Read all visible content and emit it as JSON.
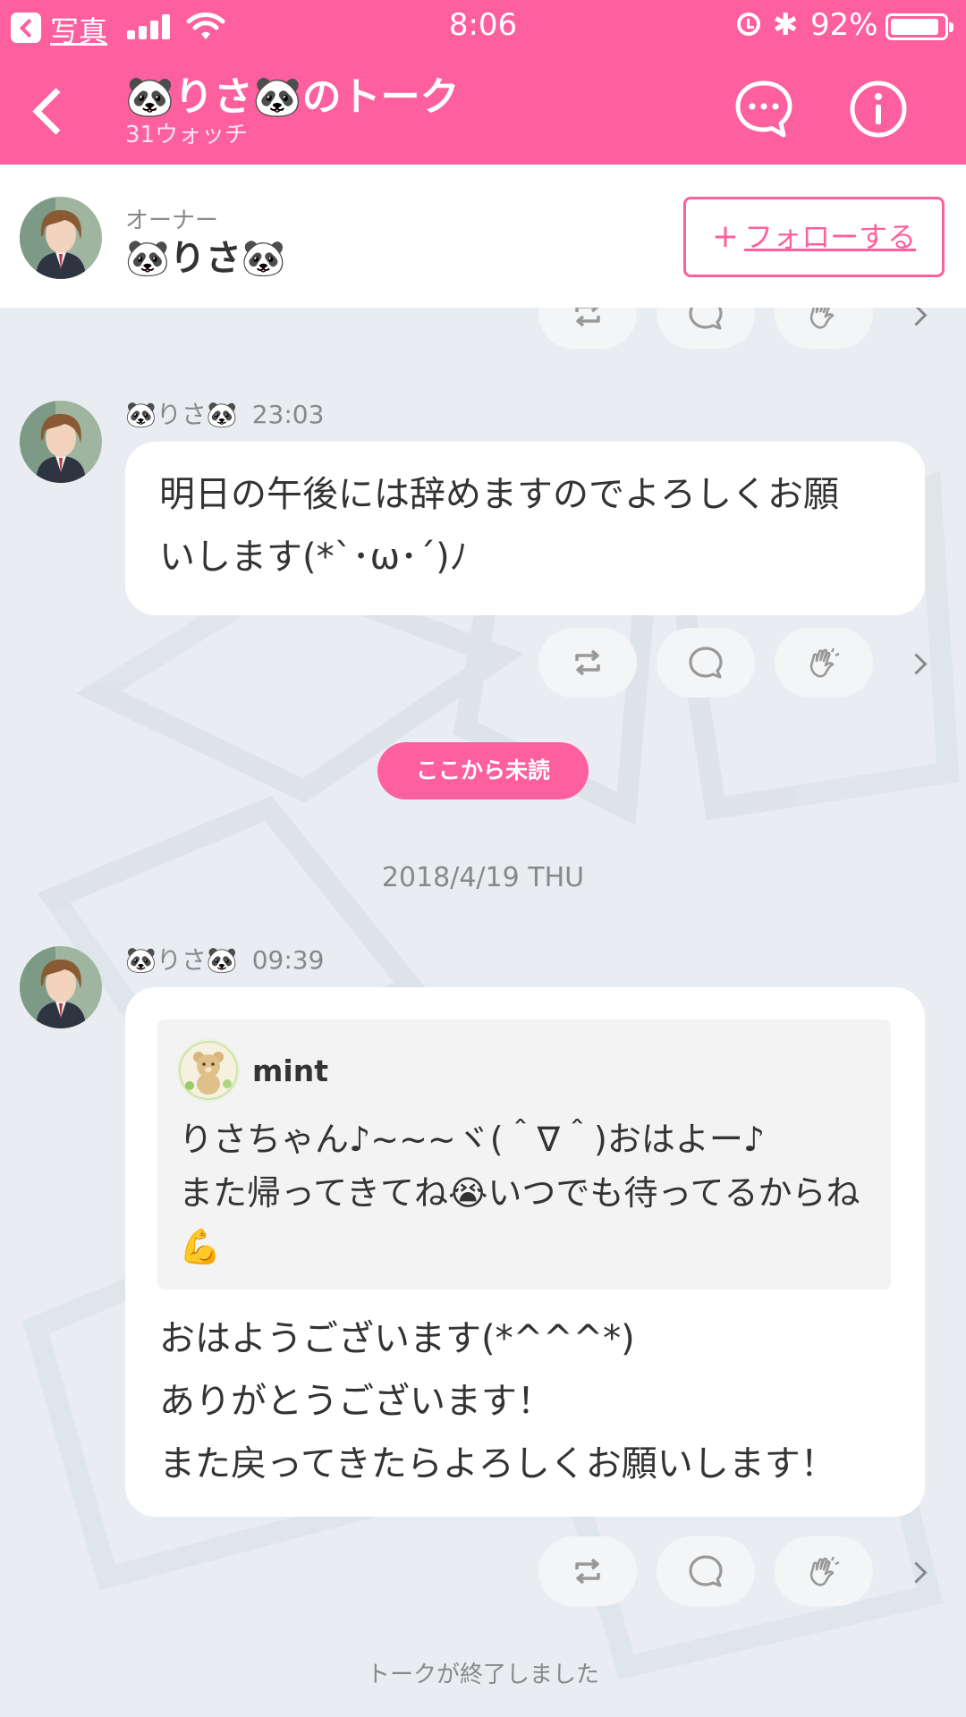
{
  "status_bar": {
    "back_label": "写真",
    "time": "8:06",
    "battery": "92%",
    "battery_level": 0.92
  },
  "nav": {
    "title": "🐼りさ🐼のトーク",
    "subtitle": "31ウォッチ"
  },
  "owner": {
    "role": "オーナー",
    "name": "🐼りさ🐼",
    "follow_label": "フォローする"
  },
  "messages": [
    {
      "sender": "🐼りさ🐼",
      "time": "23:03",
      "lines": [
        "明日の午後には辞めますのでよろしくお願",
        "いします(*`･ω･´)ﾉ"
      ]
    },
    {
      "sender": "🐼りさ🐼",
      "time": "09:39",
      "quote": {
        "user": "mint",
        "lines": [
          "りさちゃん♪~~~ヾ(＾∇＾)おはよー♪",
          "また帰ってきてね😭いつでも待ってるからね",
          "💪"
        ]
      },
      "lines": [
        "おはようございます(*^^^*)",
        "ありがとうございます！",
        "また戻ってきたらよろしくお願いします！"
      ]
    }
  ],
  "unread_label": "ここから未読",
  "date_divider": "2018/4/19 THU",
  "ended_label": "トークが終了しました",
  "colors": {
    "accent": "#fd5f9f",
    "background": "#e9edf1",
    "bubble": "#ffffff"
  },
  "icons": [
    "repost-icon",
    "comment-icon",
    "clap-icon",
    "chevron-right-icon",
    "chat-bubble-icon",
    "info-icon",
    "back-chevron-icon"
  ]
}
